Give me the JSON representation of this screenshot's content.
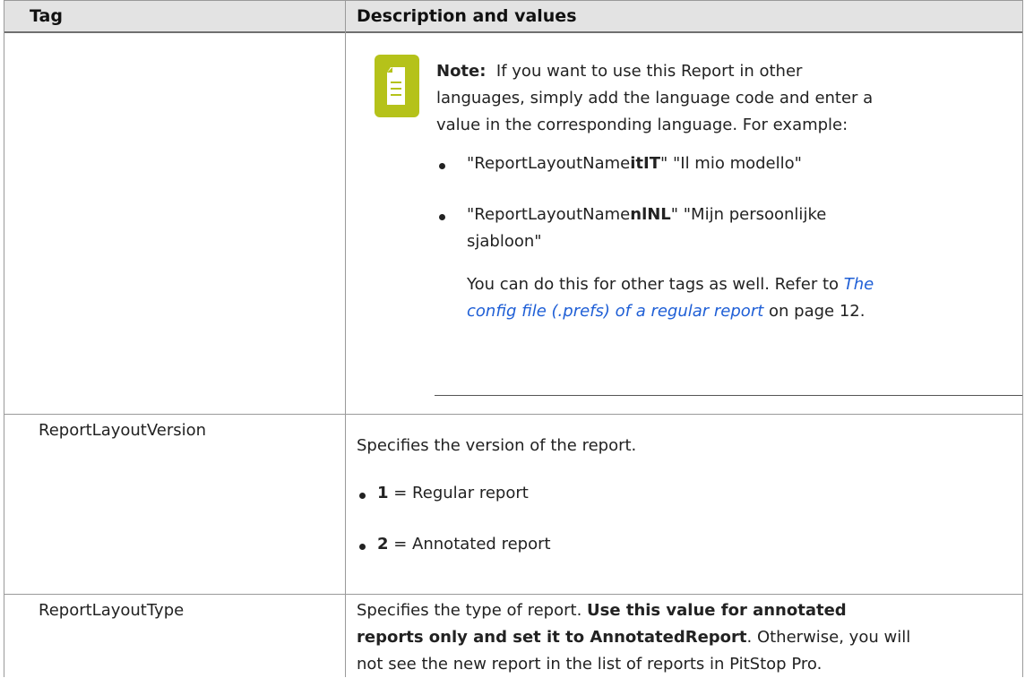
{
  "header": {
    "col1": "Tag",
    "col2": "Description and values"
  },
  "rows": [
    {
      "note": {
        "label": "Note:",
        "line1": "If you want to use this Report in other",
        "line2": "languages, simply add the language code and enter a",
        "line3": "value in the corresponding language. For example:",
        "b1_pre": "\"ReportLayoutName",
        "b1_bold": "itIT",
        "b1_post": "\" \"Il mio modello\"",
        "b2_pre": "\"ReportLayoutName",
        "b2_bold": "nlNL",
        "b2_post": "\" \"Mijn persoonlijke",
        "b2_line2": "sjabloon\"",
        "ref_pre": "You can do this for other tags as well. Refer to ",
        "ref_link1": "The",
        "ref_link2": "config file (.prefs) of a regular report",
        "ref_post": " on page 12."
      }
    },
    {
      "tag": "ReportLayoutVersion",
      "desc": "Specifies the version of the report.",
      "v1_bold": "1",
      "v1_text": " = Regular report",
      "v2_bold": "2",
      "v2_text": " = Annotated report"
    },
    {
      "tag": "ReportLayoutType",
      "l1_pre": "Specifies the type of report. ",
      "l1_bold": "Use this value for annotated",
      "l2_bold": "reports only and set it to AnnotatedReport",
      "l2_post": ". Otherwise, you will",
      "l3": "not see the new report in the list of reports in PitStop Pro."
    }
  ],
  "icon": {
    "name": "note-document-icon",
    "color": "#b5c21a"
  }
}
